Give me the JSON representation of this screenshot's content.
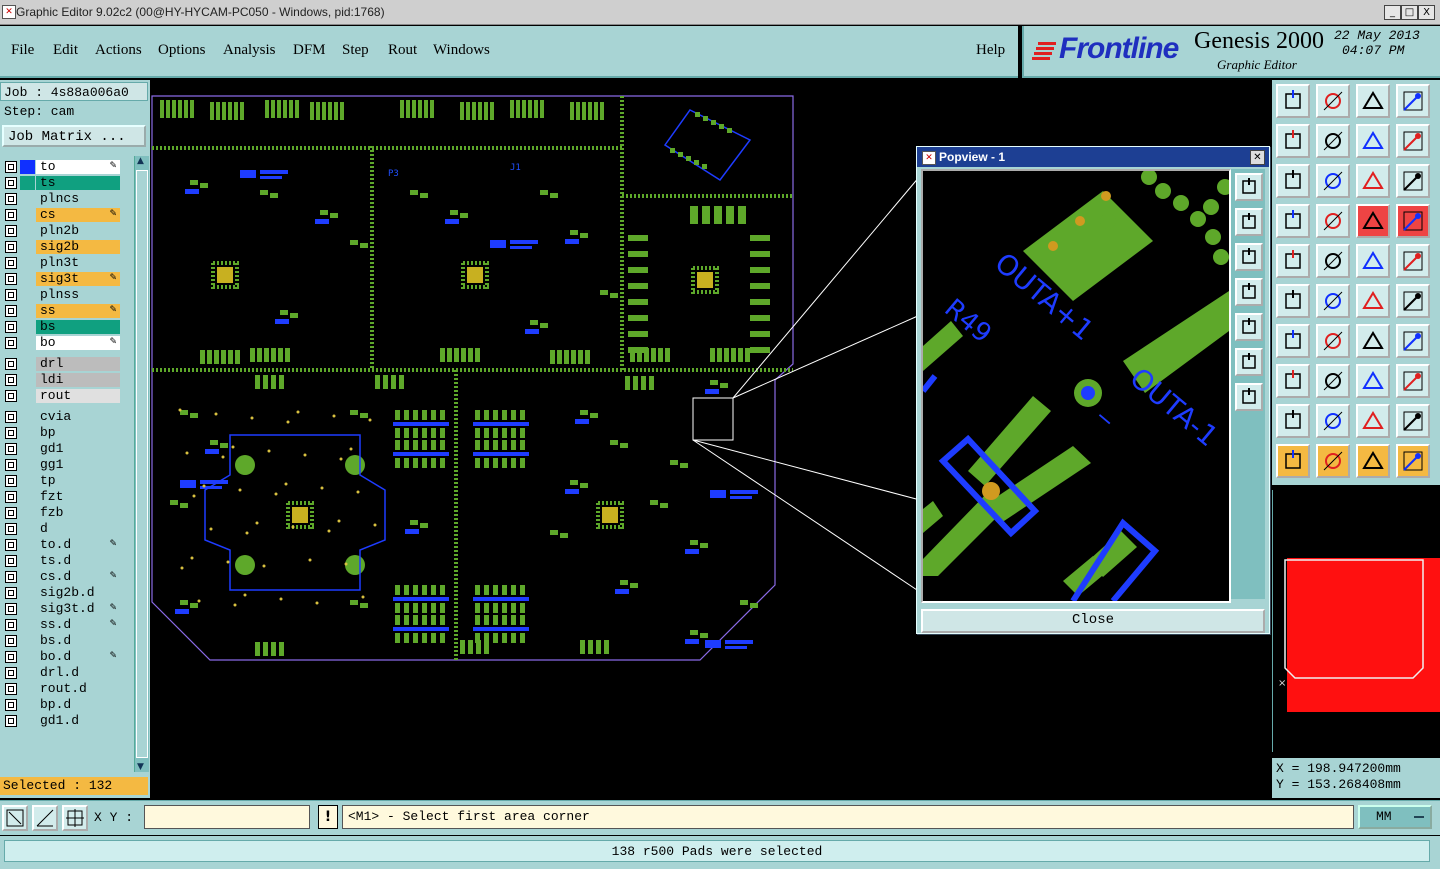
{
  "window": {
    "title": "Graphic Editor 9.02c2 (00@HY-HYCAM-PC050 - Windows, pid:1768)",
    "btn_min": "_",
    "btn_max": "□",
    "btn_close": "X"
  },
  "menu": {
    "file": "File",
    "edit": "Edit",
    "actions": "Actions",
    "options": "Options",
    "analysis": "Analysis",
    "dfm": "DFM",
    "step": "Step",
    "rout": "Rout",
    "windows": "Windows",
    "help": "Help"
  },
  "logo": {
    "brand": "Frontline",
    "product": "Genesis 2000",
    "subtitle": "Graphic Editor",
    "date": "22 May 2013",
    "time": "04:07 PM"
  },
  "left": {
    "job": "Job : 4s88a006a0",
    "step": "Step: cam",
    "job_matrix": "Job Matrix ...",
    "selected": "Selected : 132"
  },
  "layers": [
    {
      "name": "to",
      "color": "#ffffff",
      "swatch": "#1030ff",
      "edit": "✎"
    },
    {
      "name": "ts",
      "color": "#10a080",
      "swatch": "#10a080",
      "edit": ""
    },
    {
      "name": "plncs",
      "color": "#a8d4d4",
      "swatch": "",
      "edit": ""
    },
    {
      "name": "cs",
      "color": "#f4b942",
      "swatch": "",
      "edit": "✎"
    },
    {
      "name": "pln2b",
      "color": "#a8d4d4",
      "swatch": "",
      "edit": ""
    },
    {
      "name": "sig2b",
      "color": "#f4b942",
      "swatch": "",
      "edit": ""
    },
    {
      "name": "pln3t",
      "color": "#a8d4d4",
      "swatch": "",
      "edit": ""
    },
    {
      "name": "sig3t",
      "color": "#f4b942",
      "swatch": "",
      "edit": "✎"
    },
    {
      "name": "plnss",
      "color": "#a8d4d4",
      "swatch": "",
      "edit": ""
    },
    {
      "name": "ss",
      "color": "#f4b942",
      "swatch": "",
      "edit": "✎"
    },
    {
      "name": "bs",
      "color": "#10a080",
      "swatch": "",
      "edit": ""
    },
    {
      "name": "bo",
      "color": "#ffffff",
      "swatch": "",
      "edit": "✎"
    },
    {
      "name": "drl",
      "color": "#bcbcbc",
      "swatch": "",
      "edit": ""
    },
    {
      "name": "ldi",
      "color": "#bcbcbc",
      "swatch": "",
      "edit": ""
    },
    {
      "name": "rout",
      "color": "#e0e0e0",
      "swatch": "",
      "edit": ""
    },
    {
      "name": "cvia",
      "color": "#a8d4d4",
      "swatch": "",
      "edit": ""
    },
    {
      "name": "bp",
      "color": "#a8d4d4",
      "swatch": "",
      "edit": ""
    },
    {
      "name": "gd1",
      "color": "#a8d4d4",
      "swatch": "",
      "edit": ""
    },
    {
      "name": "gg1",
      "color": "#a8d4d4",
      "swatch": "",
      "edit": ""
    },
    {
      "name": "tp",
      "color": "#a8d4d4",
      "swatch": "",
      "edit": ""
    },
    {
      "name": "fzt",
      "color": "#a8d4d4",
      "swatch": "",
      "edit": ""
    },
    {
      "name": "fzb",
      "color": "#a8d4d4",
      "swatch": "",
      "edit": ""
    },
    {
      "name": "d",
      "color": "#a8d4d4",
      "swatch": "",
      "edit": ""
    },
    {
      "name": "to.d",
      "color": "#a8d4d4",
      "swatch": "",
      "edit": "✎"
    },
    {
      "name": "ts.d",
      "color": "#a8d4d4",
      "swatch": "",
      "edit": ""
    },
    {
      "name": "cs.d",
      "color": "#a8d4d4",
      "swatch": "",
      "edit": "✎"
    },
    {
      "name": "sig2b.d",
      "color": "#a8d4d4",
      "swatch": "",
      "edit": ""
    },
    {
      "name": "sig3t.d",
      "color": "#a8d4d4",
      "swatch": "",
      "edit": "✎"
    },
    {
      "name": "ss.d",
      "color": "#a8d4d4",
      "swatch": "",
      "edit": "✎"
    },
    {
      "name": "bs.d",
      "color": "#a8d4d4",
      "swatch": "",
      "edit": ""
    },
    {
      "name": "bo.d",
      "color": "#a8d4d4",
      "swatch": "",
      "edit": "✎"
    },
    {
      "name": "drl.d",
      "color": "#a8d4d4",
      "swatch": "",
      "edit": ""
    },
    {
      "name": "rout.d",
      "color": "#a8d4d4",
      "swatch": "",
      "edit": ""
    },
    {
      "name": "bp.d",
      "color": "#a8d4d4",
      "swatch": "",
      "edit": ""
    },
    {
      "name": "gd1.d",
      "color": "#a8d4d4",
      "swatch": "",
      "edit": ""
    }
  ],
  "popview": {
    "title": "Popview - 1",
    "close": "Close",
    "labels": {
      "outa1": "OUTA+1",
      "outa2": "OUTA-1",
      "r49": "R49",
      "dash": "_"
    }
  },
  "coords": {
    "x": "X  =  198.947200mm",
    "y": "Y  =  153.268408mm"
  },
  "bottom": {
    "xy_label": "X Y :",
    "xy_value": "",
    "warn": "!",
    "prompt": "<M1> - Select first area corner",
    "units": "MM",
    "status": "138 r500 Pads were selected"
  },
  "pcb_labels": {
    "j1": "J1",
    "p3": "P3"
  }
}
